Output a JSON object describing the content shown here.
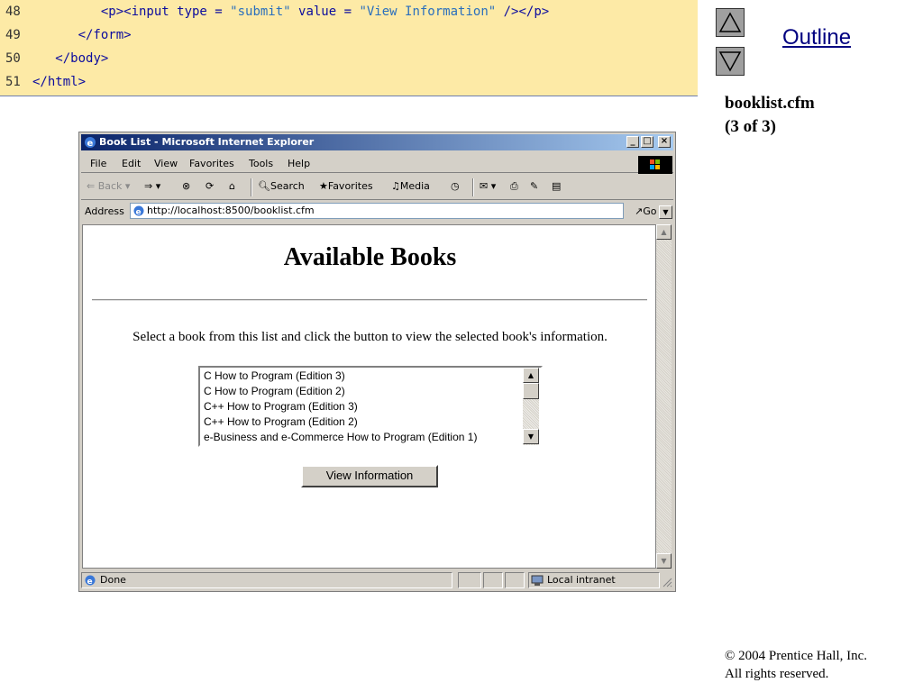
{
  "code": {
    "lines": [
      {
        "num": "48",
        "indent": "         ",
        "parts": [
          {
            "t": "<p><input type = ",
            "c": "tag"
          },
          {
            "t": "\"submit\"",
            "c": "str"
          },
          {
            "t": " value = ",
            "c": "tag"
          },
          {
            "t": "\"View Information\"",
            "c": "str"
          },
          {
            "t": " /></p>",
            "c": "tag"
          }
        ]
      },
      {
        "num": "49",
        "indent": "      ",
        "parts": [
          {
            "t": "</form>",
            "c": "tag"
          }
        ]
      },
      {
        "num": "50",
        "indent": "   ",
        "parts": [
          {
            "t": "</body>",
            "c": "tag"
          }
        ]
      },
      {
        "num": "51",
        "indent": "",
        "parts": [
          {
            "t": "</html>",
            "c": "tag"
          }
        ]
      }
    ]
  },
  "outline": {
    "label": "Outline",
    "file_name": "booklist.cfm",
    "part": "(3 of 3)"
  },
  "copyright": {
    "line1": "© 2004 Prentice Hall, Inc.",
    "line2": "All rights reserved."
  },
  "browser": {
    "title": "Book List - Microsoft Internet Explorer",
    "menu": [
      "File",
      "Edit",
      "View",
      "Favorites",
      "Tools",
      "Help"
    ],
    "toolbar": {
      "back": "Back",
      "search": "Search",
      "favorites": "Favorites",
      "media": "Media"
    },
    "address_label": "Address",
    "address_value": "http://localhost:8500/booklist.cfm",
    "go_label": "Go",
    "status_text": "Done",
    "zone_text": "Local intranet"
  },
  "page": {
    "heading": "Available Books",
    "instructions": "Select a book from this list and click the button to view the selected book's information.",
    "books": [
      "C How to Program (Edition 3)",
      "C How to Program (Edition 2)",
      "C++ How to Program (Edition 3)",
      "C++ How to Program (Edition 2)",
      "e-Business and e-Commerce How to Program (Edition 1)"
    ],
    "button_label": "View Information"
  },
  "colors": {
    "code_background": "#fdeaa6",
    "code_tag": "#0c0c9e",
    "code_string": "#2a6fbd",
    "title_bar": "#0a246a",
    "outline_link": "#000080"
  }
}
